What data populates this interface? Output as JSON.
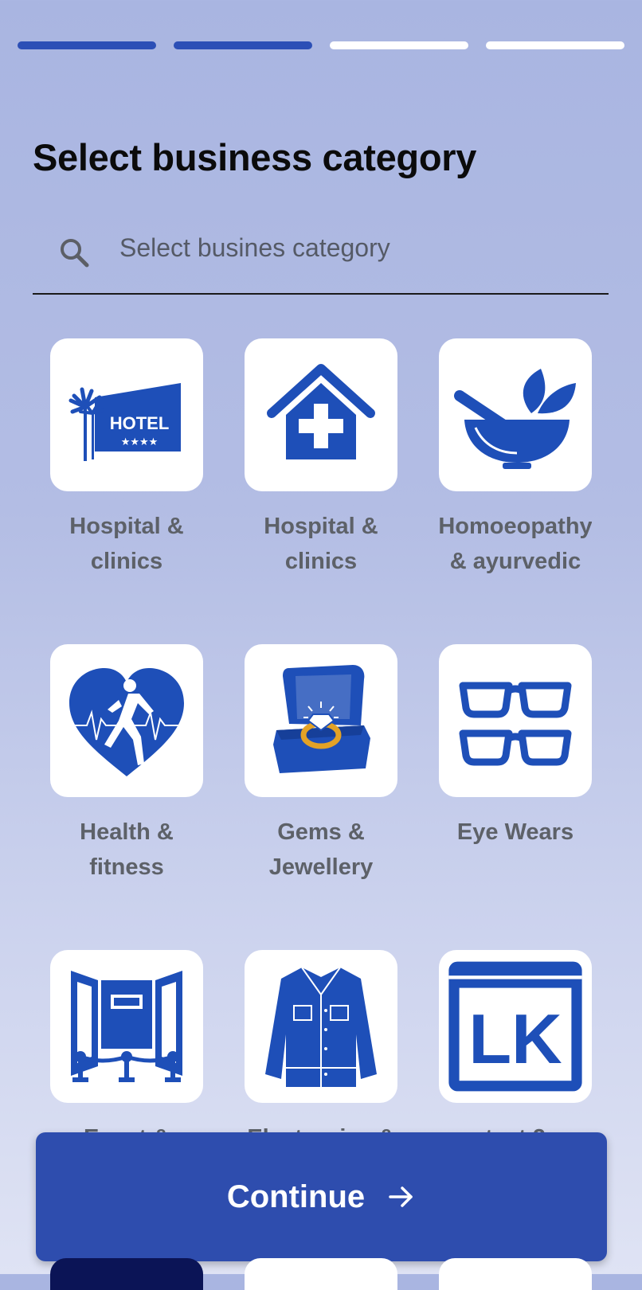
{
  "progress": {
    "total_steps": 4,
    "completed_steps": 2
  },
  "title": "Select business category",
  "search": {
    "placeholder": "Select busines category",
    "icon": "search-icon"
  },
  "categories": [
    {
      "label": "Hospital &\nclinics",
      "icon": "hotel-icon"
    },
    {
      "label": "Hospital &\nclinics",
      "icon": "house-medical-cross-icon"
    },
    {
      "label": "Homoeopathy\n& ayurvedic",
      "icon": "mortar-pestle-leaves-icon"
    },
    {
      "label": "Health &\nfitness",
      "icon": "heart-runner-icon"
    },
    {
      "label": "Gems &\nJewellery",
      "icon": "ring-box-icon"
    },
    {
      "label": "Eye Wears",
      "icon": "glasses-icon"
    },
    {
      "label": "Event &",
      "icon": "event-stage-icon"
    },
    {
      "label": "Electronics &",
      "icon": "denim-jacket-icon"
    },
    {
      "label": "test 2",
      "icon": "lk-logo-icon"
    }
  ],
  "continue_button": {
    "label": "Continue",
    "icon": "arrow-right-icon"
  },
  "colors": {
    "accent": "#2c4fb6",
    "icon_blue": "#1e4fb8",
    "label_gray": "#5d6168"
  }
}
